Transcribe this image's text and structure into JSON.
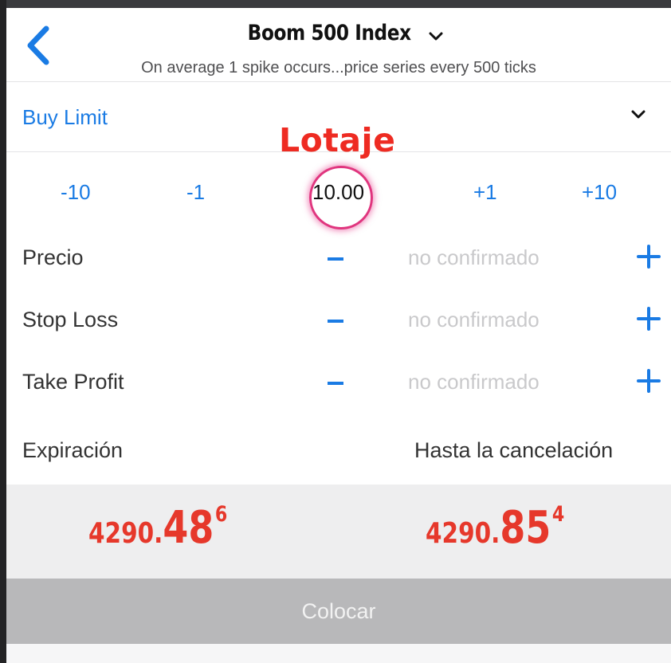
{
  "header": {
    "title": "Boom 500 Index",
    "subtitle": "On average 1 spike occurs...price series every 500 ticks"
  },
  "order": {
    "type": "Buy Limit"
  },
  "annotation": {
    "label": "Lotaje",
    "color": "#ee2b22",
    "circle_color": "#e0357e"
  },
  "volume": {
    "minus10": "-10",
    "minus1": "-1",
    "value": "10.00",
    "plus1": "+1",
    "plus10": "+10"
  },
  "params": [
    {
      "label": "Precio",
      "value": "no confirmado"
    },
    {
      "label": "Stop Loss",
      "value": "no confirmado"
    },
    {
      "label": "Take Profit",
      "value": "no confirmado"
    }
  ],
  "expiration": {
    "label": "Expiración",
    "value": "Hasta la cancelación"
  },
  "prices": {
    "bid": {
      "main": "4290.",
      "big": "48",
      "sup": "6"
    },
    "ask": {
      "main": "4290.",
      "big": "85",
      "sup": "4"
    }
  },
  "place_button": {
    "label": "Colocar"
  },
  "colors": {
    "accent": "#1a7be4",
    "price": "#e6382b",
    "button_bg": "#b8b8ba"
  },
  "icons": {
    "back": "chevron-left-icon",
    "title_dropdown": "chevron-down-icon",
    "order_dropdown": "chevron-down-icon",
    "plus": "plus-icon",
    "minus": "minus-icon"
  }
}
